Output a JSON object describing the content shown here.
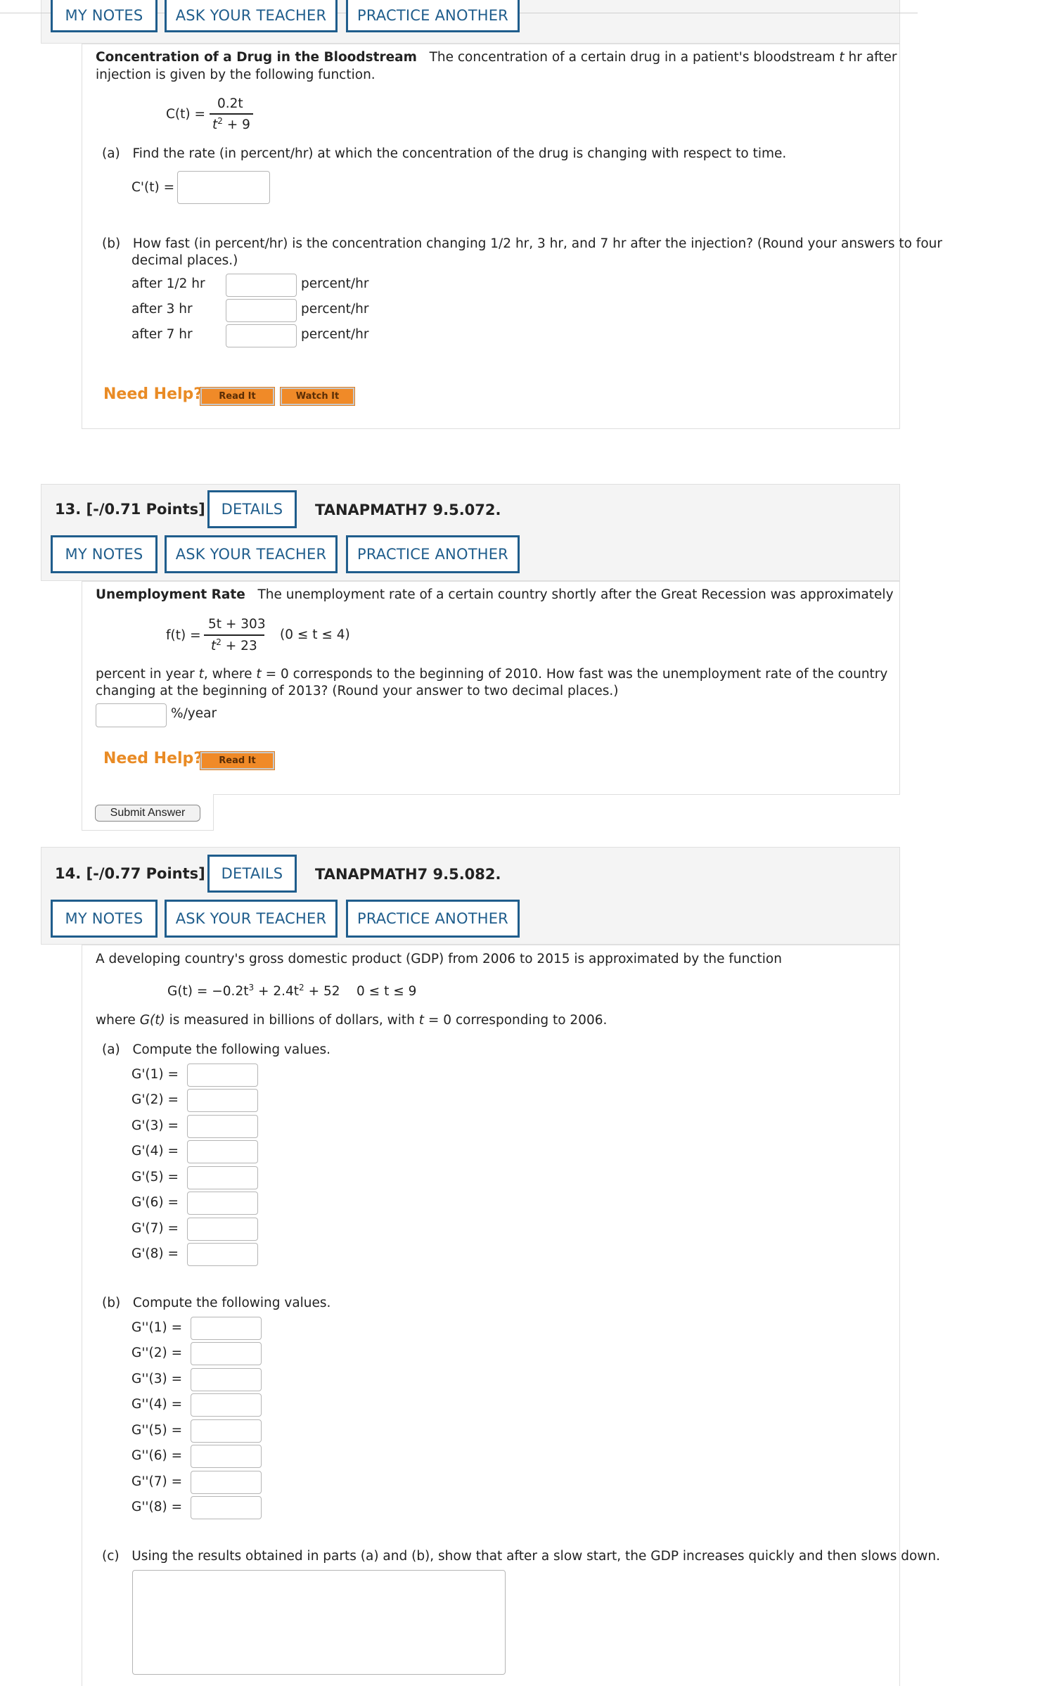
{
  "top_buttons": {
    "my_notes": "MY NOTES",
    "ask_teacher": "ASK YOUR TEACHER",
    "practice_another": "PRACTICE ANOTHER"
  },
  "q12": {
    "title": "Concentration of a Drug in the Bloodstream",
    "intro_1": "The concentration of a certain drug in a patient's bloodstream",
    "intro_var": "t",
    "intro_2": "hr after",
    "intro_line2": "injection is given by the following function.",
    "func_lhs": "C(t) =",
    "func_num": "0.2t",
    "func_den_base": "t",
    "func_den_exp": "2",
    "func_den_rest": " + 9",
    "part_a_label": "(a)",
    "part_a_text": "Find the rate (in percent/hr) at which the concentration of the drug is changing with respect to time.",
    "part_a_lhs": "C'(t) =",
    "part_b_label": "(b)",
    "part_b_text_1": "How fast (in percent/hr) is the concentration changing 1/2 hr, 3 hr, and 7 hr after the injection? (Round your answers to four",
    "part_b_text_2": "decimal places.)",
    "rows": [
      {
        "label": "after 1/2 hr",
        "unit": "percent/hr"
      },
      {
        "label": "after 3 hr",
        "unit": "percent/hr"
      },
      {
        "label": "after 7 hr",
        "unit": "percent/hr"
      }
    ],
    "need_help": "Need Help?",
    "read_it": "Read It",
    "watch_it": "Watch It"
  },
  "q13": {
    "points": "13.  [-/0.71 Points]",
    "details": "DETAILS",
    "code": "TANAPMATH7 9.5.072.",
    "my_notes": "MY NOTES",
    "ask_teacher": "ASK YOUR TEACHER",
    "practice_another": "PRACTICE ANOTHER",
    "title": "Unemployment Rate",
    "intro": "The unemployment rate of a certain country shortly after the Great Recession was approximately",
    "func_lhs": "f(t) =",
    "func_num": "5t + 303",
    "func_den_base": "t",
    "func_den_exp": "2",
    "func_den_rest": " + 23",
    "domain": "(0 ≤ t ≤ 4)",
    "body_1a": "percent in year",
    "body_1b": "t",
    "body_1c": ", where",
    "body_1d": "t",
    "body_1e": "= 0 corresponds to the beginning of 2010. How fast was the unemployment rate of the country",
    "body_2": "changing at the beginning of 2013? (Round your answer to two decimal places.)",
    "unit": "%/year",
    "need_help": "Need Help?",
    "read_it": "Read It",
    "submit": "Submit Answer"
  },
  "q14": {
    "points": "14.  [-/0.77 Points]",
    "details": "DETAILS",
    "code": "TANAPMATH7 9.5.082.",
    "my_notes": "MY NOTES",
    "ask_teacher": "ASK YOUR TEACHER",
    "practice_another": "PRACTICE ANOTHER",
    "intro": "A developing country's gross domestic product (GDP) from 2006 to 2015 is approximated by the function",
    "func_a": "G(t) = −0.2t",
    "func_exp1": "3",
    "func_b": " + 2.4t",
    "func_exp2": "2",
    "func_c": " + 52",
    "func_domain": "0 ≤ t ≤ 9",
    "where_1": "where",
    "where_2": "G(t)",
    "where_3": "is measured in billions of dollars, with",
    "where_4": "t",
    "where_5": "= 0 corresponding to 2006.",
    "part_a_label": "(a)",
    "part_a_text": "Compute the following values.",
    "a_rows": [
      "G'(1)  =",
      "G'(2)  =",
      "G'(3)  =",
      "G'(4)  =",
      "G'(5)  =",
      "G'(6)  =",
      "G'(7)  =",
      "G'(8)  ="
    ],
    "part_b_label": "(b)",
    "part_b_text": "Compute the following values.",
    "b_rows": [
      "G''(1)  =",
      "G''(2)  =",
      "G''(3)  =",
      "G''(4)  =",
      "G''(5)  =",
      "G''(6)  =",
      "G''(7)  =",
      "G''(8)  ="
    ],
    "part_c_label": "(c)",
    "part_c_text": "Using the results obtained in parts (a) and (b), show that after a slow start, the GDP increases quickly and then slows down."
  }
}
